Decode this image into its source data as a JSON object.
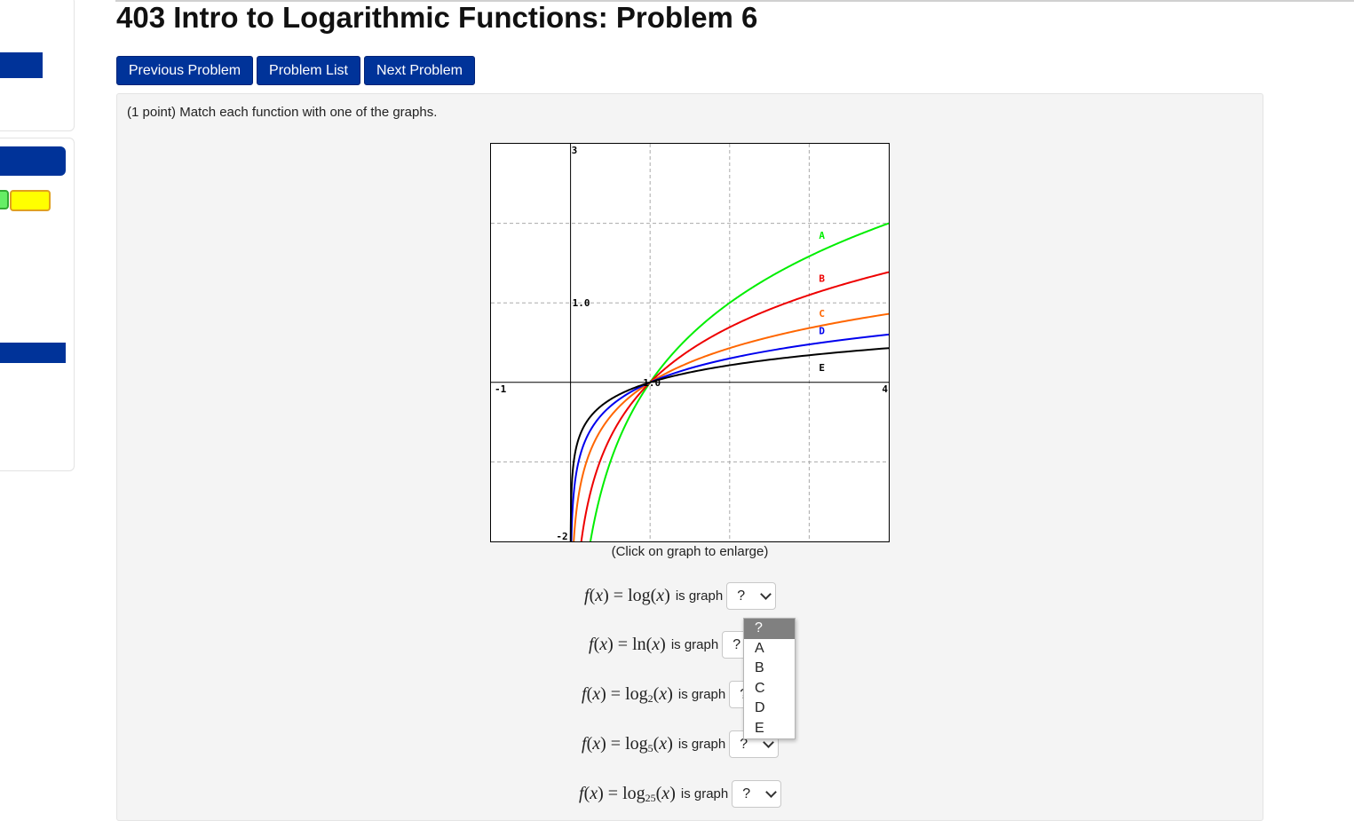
{
  "page": {
    "title": "403 Intro to Logarithmic Functions: Problem 6"
  },
  "nav": {
    "previous": "Previous Problem",
    "list": "Problem List",
    "next": "Next Problem"
  },
  "problem": {
    "statement": "(1 point) Match each function with one of the graphs.",
    "caption": "(Click on graph to enlarge)",
    "is_graph_label": "is graph",
    "rows": [
      {
        "func": "log",
        "base": "",
        "selected": "?"
      },
      {
        "func": "ln",
        "base": "",
        "selected": "?"
      },
      {
        "func": "log",
        "base": "2",
        "selected": "?"
      },
      {
        "func": "log",
        "base": "5",
        "selected": "?"
      },
      {
        "func": "log",
        "base": "25",
        "selected": "?"
      }
    ],
    "dropdown_options": [
      "?",
      "A",
      "B",
      "C",
      "D",
      "E"
    ]
  },
  "colors": {
    "accent": "#003399",
    "A": "#00ee00",
    "B": "#ee0000",
    "C": "#ff6600",
    "D": "#0000ee",
    "E": "#000000"
  },
  "chart_data": {
    "type": "line",
    "xlim": [
      -1,
      4
    ],
    "ylim": [
      -2,
      3
    ],
    "tick_labels": [
      "-1",
      "4",
      "-2",
      "3",
      "1.0",
      "1.0"
    ],
    "grid": true,
    "series": [
      {
        "name": "A",
        "function": "log base 2 of x"
      },
      {
        "name": "B",
        "function": "ln(x)"
      },
      {
        "name": "C",
        "function": "log base 5 of x"
      },
      {
        "name": "D",
        "function": "log base 10 of x"
      },
      {
        "name": "E",
        "function": "log base 25 of x"
      }
    ]
  }
}
